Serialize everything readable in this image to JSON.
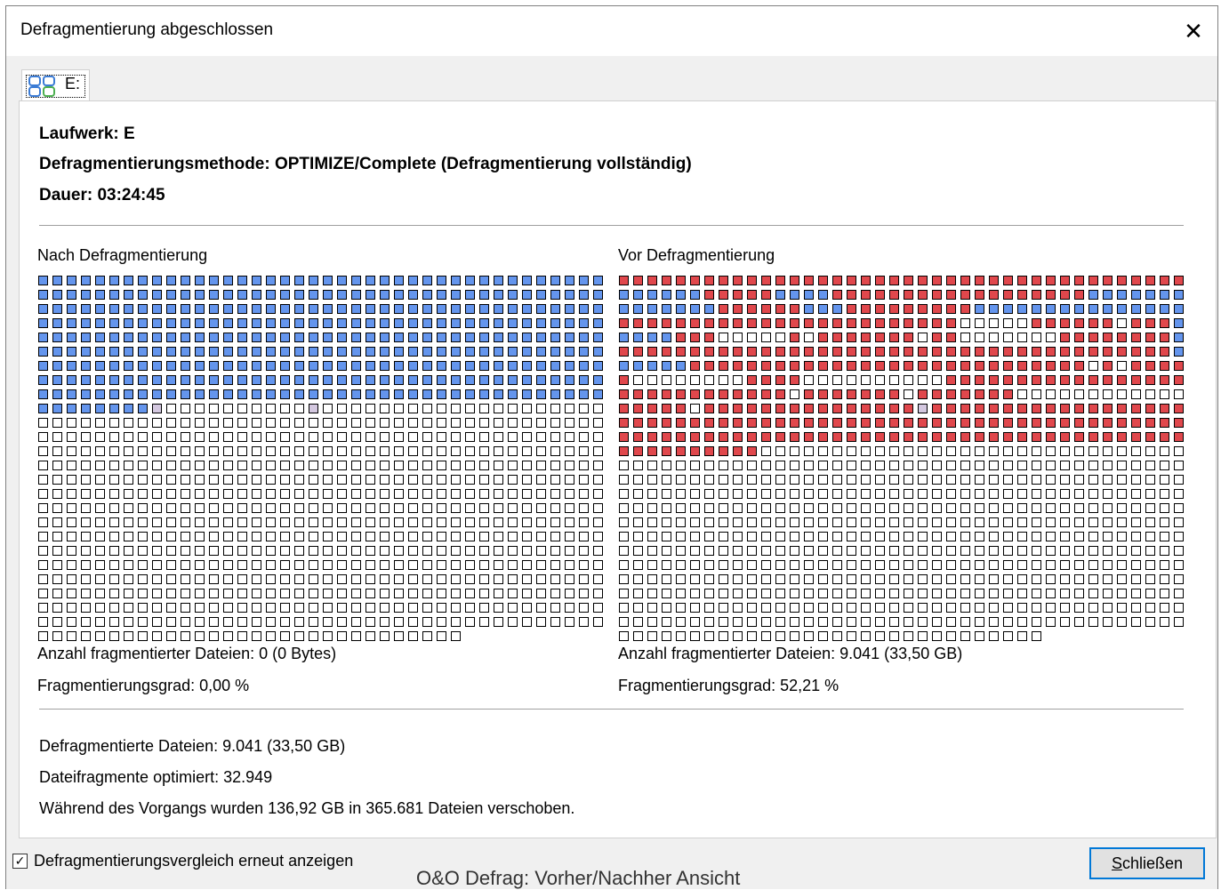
{
  "window": {
    "title": "Defragmentierung abgeschlossen",
    "close_glyph": "✕"
  },
  "tab": {
    "icon": "drive-icon",
    "label": "E:"
  },
  "info": {
    "drive": "Laufwerk: E",
    "method": "Defragmentierungsmethode: OPTIMIZE/Complete (Defragmentierung vollständig)",
    "duration": "Dauer: 03:24:45"
  },
  "colors": {
    "used": "#6495ed",
    "fragmented": "#e0474c",
    "free": "#ffffff",
    "locked": "#d4c8e0"
  },
  "after": {
    "label": "Nach Defragmentierung",
    "fragmented_files": "Anzahl fragmentierter Dateien: 0 (0 Bytes)",
    "degree": "Fragmentierungsgrad: 0,00 %"
  },
  "before": {
    "label": "Vor Defragmentierung",
    "fragmented_files": "Anzahl fragmentierter Dateien: 9.041 (33,50 GB)",
    "degree": "Fragmentierungsgrad: 52,21 %"
  },
  "summary": {
    "defragmented": "Defragmentierte Dateien: 9.041 (33,50 GB)",
    "fragments": "Dateifragmente optimiert: 32.949",
    "moved": "Während des Vorgangs wurden 136,92 GB in 365.681 Dateien verschoben."
  },
  "footer": {
    "checkbox_label": "Defragmentierungsvergleich erneut anzeigen",
    "checkbox_checked": true,
    "close_button_prefix": "",
    "close_button_mnemonic": "S",
    "close_button_rest": "chließen",
    "caption": "O&O Defrag: Vorher/Nachher Ansicht"
  },
  "maps": {
    "after": {
      "rows": [
        "UUUUUUUUUUUUUUUUUUUUUUUUUUUUUUUUUUUUUUUU",
        "UUUUUUUUUUUUUUUUUUUUUUUUUUUUUUUUUUUUUUUU",
        "UUUUUUUUUUUUUUUUUUUUUUUUUUUUUUUUUUUUUUUU",
        "UUUUUUUUUUUUUUUUUUUUUUUUUUUUUUUUUUUUUUUU",
        "UUUUUUUUUUUUUUUUUUUUUUUUUUUUUUUUUUUUUUUU",
        "UUUUUUUUUUUUUUUUUUUUUUUUUUUUUUUUUUUUUUUU",
        "UUUUUUUUUUUUUUUUUUUUUUUUUUUUUUUUUUUUUUUU",
        "UUUUUUUUUUUUUUUUUUUUUUUUUUUUUUUUUUUUUUUU",
        "UUUUUUUUUUUUUUUUUUUUUUUUUUUUUUUUUUUUUUUU",
        "UUUUUUUULFFFFFFFFFFLFFFFFFFFFFFFFFFFFFFF",
        "FFFFFFFFFFFFFFFFFFFFFFFFFFFFFFFFFFFFFFFF",
        "FFFFFFFFFFFFFFFFFFFFFFFFFFFFFFFFFFFFFFFF",
        "FFFFFFFFFFFFFFFFFFFFFFFFFFFFFFFFFFFFFFFF",
        "FFFFFFFFFFFFFFFFFFFFFFFFFFFFFFFFFFFFFFFF",
        "FFFFFFFFFFFFFFFFFFFFFFFFFFFFFFFFFFFFFFFF",
        "FFFFFFFFFFFFFFFFFFFFFFFFFFFFFFFFFFFFFFFF",
        "FFFFFFFFFFFFFFFFFFFFFFFFFFFFFFFFFFFFFFFF",
        "FFFFFFFFFFFFFFFFFFFFFFFFFFFFFFFFFFFFFFFF",
        "FFFFFFFFFFFFFFFFFFFFFFFFFFFFFFFFFFFFFFFF",
        "FFFFFFFFFFFFFFFFFFFFFFFFFFFFFFFFFFFFFFFF",
        "FFFFFFFFFFFFFFFFFFFFFFFFFFFFFFFFFFFFFFFF",
        "FFFFFFFFFFFFFFFFFFFFFFFFFFFFFFFFFFFFFFFF",
        "FFFFFFFFFFFFFFFFFFFFFFFFFFFFFFFFFFFFFFFF",
        "FFFFFFFFFFFFFFFFFFFFFFFFFFFFFFFFFFFFFFFF",
        "FFFFFFFFFFFFFFFFFFFFFFFFFFFFFFFFFFFFFFFF",
        "FFFFFFFFFFFFFFFFFFFFFFFFFFFFFF"
      ]
    },
    "before": {
      "rows": [
        "RRRRRRRRRRRRRRRRRRRRRRRRRRRRRRRRRRRRRRRR",
        "UUUUUURRRRRUUUURRRRRRRRRRRRRRRRRRUUUUUUU",
        "UUUUUUURRRRRRUUURRRRRRRRRUUUUUUUUUUUUUUU",
        "RRRRRRRRRRRRRRRRRRRRRRRRFFFFFRRRRRRFRRRU",
        "UUUURRRFFFFFRFRRRRRRRFRRFFFFFFFRRRRRRRRU",
        "RRRRRRRRRRRRRRRRRRRRRRRRRRRRRRRRRRRRRRRU",
        "UUUUURRRRRRRRRRRRRRRRRRRRRRRRRRRRFRFRRRR",
        "RFFFFFFFFRRRRFFFFFFFFFFRRRRRRRRRRRRRRRRR",
        "RRRRRRRRRRRRFRRRRRRRFRRRRRRRFFFFFFFFFFFF",
        "RRRRRFRRRRRRRRRRRRRRRLRRRRRRRRRRRRRRRRRR",
        "RRRRRRRRRRRRRRRRRRRRRRRRRRRRRRRRRRRRRRRR",
        "RRRRRRRRRRRRRRRRRRRRRRRRRRRRRRRRRRRRRRRR",
        "RRRRRRRRRRFFFFFFFFFFFFFFFFFFFFFFFFFFFFFF",
        "FFFFFFFFFFFFFFFFFFFFFFFFFFFFFFFFFFFFFFFF",
        "FFFFFFFFFFFFFFFFFFFFFFFFFFFFFFFFFFFFFFFF",
        "FFFFFFFFFFFFFFFFFFFFFFFFFFFFFFFFFFFFFFFF",
        "FFFFFFFFFFFFFFFFFFFFFFFFFFFFFFFFFFFFFFFF",
        "FFFFFFFFFFFFFFFFFFFFFFFFFFFFFFFFFFFFFFFF",
        "FFFFFFFFFFFFFFFFFFFFFFFFFFFFFFFFFFFFFFFF",
        "FFFFFFFFFFFFFFFFFFFFFFFFFFFFFFFFFFFFFFFF",
        "FFFFFFFFFFFFFFFFFFFFFFFFFFFFFFFFFFFFFFFF",
        "FFFFFFFFFFFFFFFFFFFFFFFFFFFFFFFFFFFFFFFF",
        "FFFFFFFFFFFFFFFFFFFFFFFFFFFFFFFFFFFFFFFF",
        "FFFFFFFFFFFFFFFFFFFFFFFFFFFFFFFFFFFFFFFF",
        "FFFFFFFFFFFFFFFFFFFFFFFFFFFFFFFFFFFFFFFF",
        "FFFFFFFFFFFFFFFFFFFFFFFFFFFFFF"
      ]
    }
  }
}
